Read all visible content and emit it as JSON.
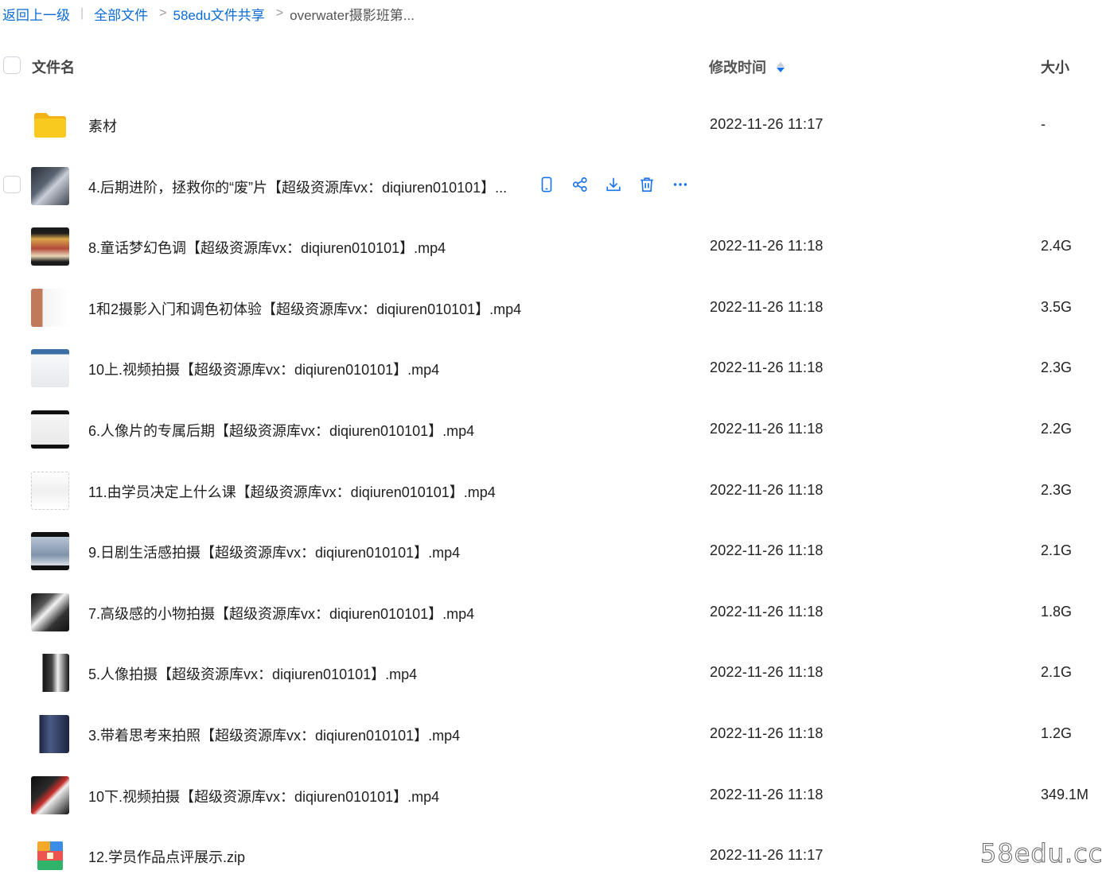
{
  "breadcrumb": {
    "back": "返回上一级",
    "separator_bar": "|",
    "all_files": "全部文件",
    "arrow": ">",
    "share_folder": "58edu文件共享",
    "current": "overwater摄影班第..."
  },
  "header": {
    "name_label": "文件名",
    "time_label": "修改时间",
    "size_label": "大小"
  },
  "rows": [
    {
      "name": "素材",
      "time": "2022-11-26 11:17",
      "size": "-",
      "type": "folder"
    },
    {
      "name": "4.后期进阶，拯救你的“废”片【超级资源库vx：diqiuren010101】...",
      "time": "",
      "size": "",
      "type": "video",
      "hovered": true
    },
    {
      "name": "8.童话梦幻色调【超级资源库vx：diqiuren010101】.mp4",
      "time": "2022-11-26 11:18",
      "size": "2.4G",
      "type": "video"
    },
    {
      "name": "1和2摄影入门和调色初体验【超级资源库vx：diqiuren010101】.mp4",
      "time": "2022-11-26 11:18",
      "size": "3.5G",
      "type": "video"
    },
    {
      "name": "10上.视频拍摄【超级资源库vx：diqiuren010101】.mp4",
      "time": "2022-11-26 11:18",
      "size": "2.3G",
      "type": "video"
    },
    {
      "name": "6.人像片的专属后期【超级资源库vx：diqiuren010101】.mp4",
      "time": "2022-11-26 11:18",
      "size": "2.2G",
      "type": "video"
    },
    {
      "name": "11.由学员决定上什么课【超级资源库vx：diqiuren010101】.mp4",
      "time": "2022-11-26 11:18",
      "size": "2.3G",
      "type": "video"
    },
    {
      "name": "9.日剧生活感拍摄【超级资源库vx：diqiuren010101】.mp4",
      "time": "2022-11-26 11:18",
      "size": "2.1G",
      "type": "video"
    },
    {
      "name": "7.高级感的小物拍摄【超级资源库vx：diqiuren010101】.mp4",
      "time": "2022-11-26 11:18",
      "size": "1.8G",
      "type": "video"
    },
    {
      "name": "5.人像拍摄【超级资源库vx：diqiuren010101】.mp4",
      "time": "2022-11-26 11:18",
      "size": "2.1G",
      "type": "video"
    },
    {
      "name": "3.带着思考来拍照【超级资源库vx：diqiuren010101】.mp4",
      "time": "2022-11-26 11:18",
      "size": "1.2G",
      "type": "video"
    },
    {
      "name": "10下.视频拍摄【超级资源库vx：diqiuren010101】.mp4",
      "time": "2022-11-26 11:18",
      "size": "349.1M",
      "type": "video"
    },
    {
      "name": "12.学员作品点评展示.zip",
      "time": "2022-11-26 11:17",
      "size": "",
      "type": "zip"
    }
  ],
  "row_actions": [
    "phone-icon",
    "share-icon",
    "download-icon",
    "delete-icon",
    "more-icon"
  ],
  "watermark": "58edu.cc",
  "colors": {
    "link": "#0a6bd6",
    "action_icon": "#1a73e8",
    "folder": "#f8c51d",
    "sort_active": "#1a73e8"
  }
}
